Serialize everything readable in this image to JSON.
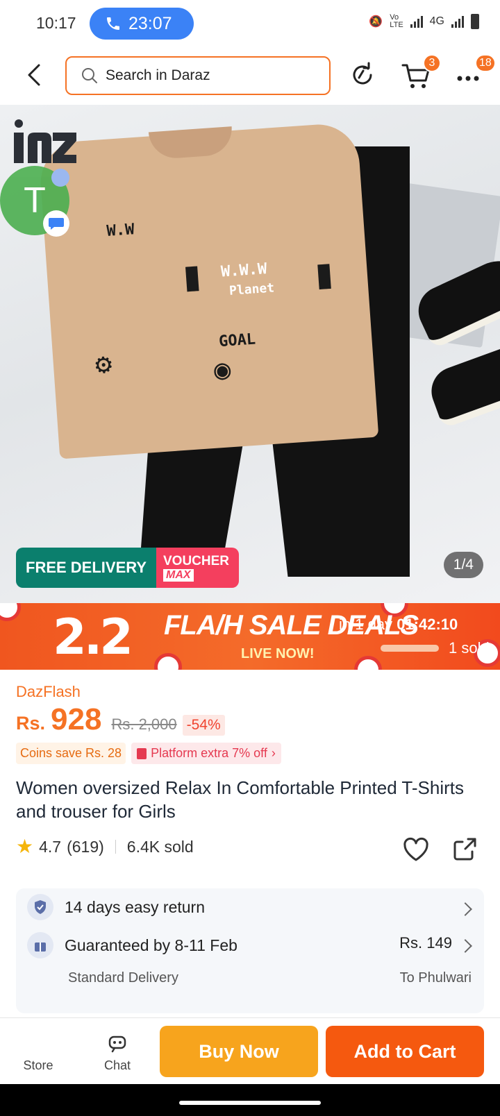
{
  "status_bar": {
    "time": "10:17",
    "call_timer": "23:07",
    "network": "4G"
  },
  "header": {
    "search_placeholder": "Search in Daraz",
    "cart_count": "3",
    "more_count": "18"
  },
  "gallery": {
    "free_delivery": "FREE DELIVERY",
    "voucher": "VOUCHER",
    "voucher_max": "MAX",
    "counter": "1/4",
    "chat_head_letter": "T"
  },
  "flash_banner": {
    "event": "2.2",
    "title": "FLA/H SALE DEALS",
    "subtitle": "LIVE NOW!",
    "ends_prefix": "in 1 day",
    "countdown": "01:42:10",
    "sold": "1 sold"
  },
  "product": {
    "campaign": "DazFlash",
    "currency": "Rs.",
    "price": "928",
    "old_price": "Rs. 2,000",
    "discount": "-54%",
    "coins_save": "Coins save Rs. 28",
    "platform_extra": "Platform extra 7% off",
    "title": "Women oversized Relax In Comfortable Printed T-Shirts and trouser for Girls",
    "rating": "4.7",
    "reviews": "(619)",
    "sold": "6.4K sold"
  },
  "services": {
    "return": "14 days easy return",
    "delivery_guarantee": "Guaranteed by 8-11 Feb",
    "delivery_type": "Standard Delivery",
    "delivery_price": "Rs. 149",
    "delivery_to": "To Phulwari"
  },
  "bottom_bar": {
    "store": "Store",
    "chat": "Chat",
    "buy_now": "Buy Now",
    "add_to_cart": "Add to Cart"
  },
  "colors": {
    "brand_orange": "#f57224",
    "buy_now": "#f7a41d",
    "add_to_cart": "#f5590f",
    "call_pill": "#3b82f6"
  }
}
